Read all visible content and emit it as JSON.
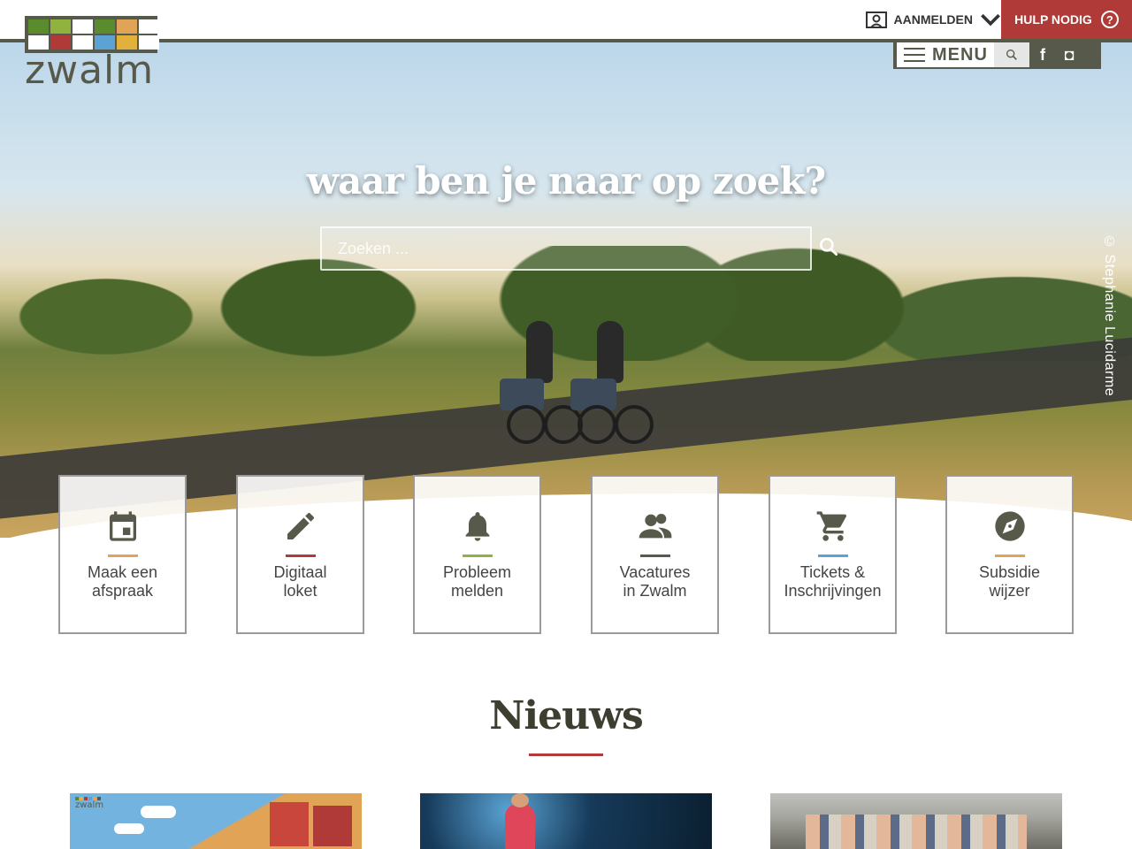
{
  "header": {
    "login_label": "AANMELDEN",
    "help_label": "HULP NODIG",
    "help_icon": "?"
  },
  "logo": {
    "text": "zwalm",
    "colors": [
      "#5a8c2e",
      "#e1b13c",
      "#ffffff",
      "#5a8c2e",
      "#e1a356",
      "#b03a37",
      "#ffffff",
      "#ffffff",
      "#ffffff",
      "#ffffff",
      "#ffffff",
      "#ffffff"
    ]
  },
  "menubar": {
    "menu_label": "MENU",
    "facebook": "f",
    "instagram": "◘"
  },
  "hero": {
    "title": "waar ben je naar op zoek?",
    "search_placeholder": "Zoeken ...",
    "credit": "© Stephanie Lucidarme"
  },
  "tiles": [
    {
      "line1": "Maak een",
      "line2": "afspraak",
      "icon": "calendar-icon",
      "accent": "#e1a356"
    },
    {
      "line1": "Digitaal",
      "line2": "loket",
      "icon": "pencil-icon",
      "accent": "#b03a37"
    },
    {
      "line1": "Probleem",
      "line2": "melden",
      "icon": "bell-icon",
      "accent": "#8fb33c"
    },
    {
      "line1": "Vacatures",
      "line2": "in Zwalm",
      "icon": "people-icon",
      "accent": "#575a4b"
    },
    {
      "line1": "Tickets &",
      "line2": "Inschrijvingen",
      "icon": "cart-icon",
      "accent": "#5aa3d4"
    },
    {
      "line1": "Subsidie",
      "line2": "wijzer",
      "icon": "compass-icon",
      "accent": "#e1a356"
    }
  ],
  "news": {
    "title": "Nieuws",
    "card1_logo": "zwalm"
  },
  "colors": {
    "brand": "#575a4b",
    "accent_red": "#b03a37"
  }
}
